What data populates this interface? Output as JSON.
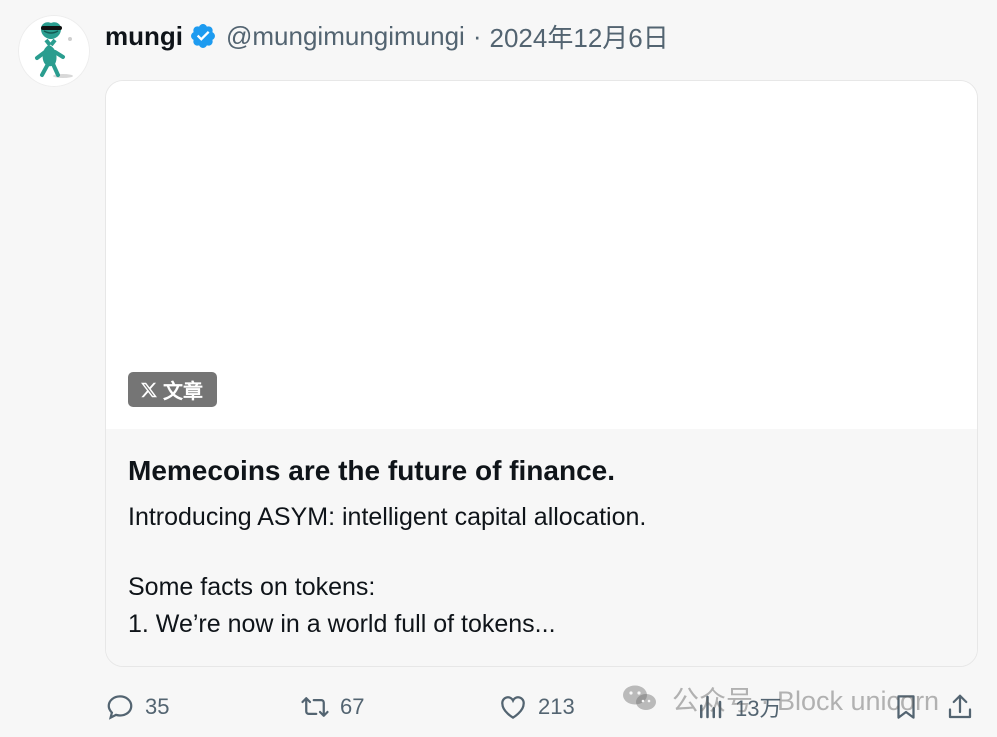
{
  "tweet": {
    "author_name": "mungi",
    "handle": "@mungimungimungi",
    "separator": "·",
    "timestamp": "2024年12月6日",
    "avatar_icon": "frog-character-icon",
    "verified_icon": "verified-badge-icon",
    "verified_color": "#1d9bf0"
  },
  "card": {
    "badge_label": "文章",
    "badge_icon": "x-logo-icon",
    "title": "Memecoins are the future of finance.",
    "lines": [
      "Introducing ASYM: intelligent capital allocation.",
      "Some facts on tokens:",
      "1. We’re now in a world full of tokens..."
    ]
  },
  "actions": {
    "reply_count": "35",
    "retweet_count": "67",
    "like_count": "213",
    "views_count": "13万",
    "icons": [
      "reply-icon",
      "retweet-icon",
      "like-icon",
      "views-icon",
      "bookmark-icon",
      "share-icon"
    ]
  },
  "watermark": {
    "text": "公众号 · Block unicorn",
    "icon": "wechat-icon"
  },
  "colors": {
    "background": "#f7f7f7",
    "text_primary": "#0f1419",
    "text_secondary": "#536471",
    "badge_background": "#757575",
    "avatar_accent": "#2a9d8f"
  }
}
